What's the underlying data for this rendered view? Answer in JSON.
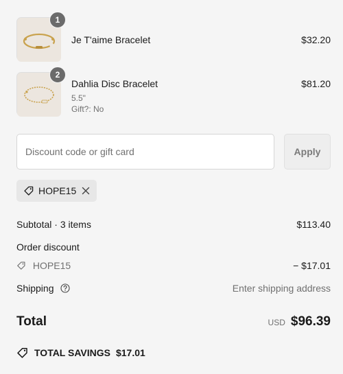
{
  "items": [
    {
      "quantity": "1",
      "name": "Je T'aime Bracelet",
      "price": "$32.20",
      "thumbnail_icon": "cuff-bracelet-image"
    },
    {
      "quantity": "2",
      "name": "Dahlia Disc Bracelet",
      "variant": "5.5\"",
      "gift": "Gift?: No",
      "price": "$81.20",
      "thumbnail_icon": "chain-bracelet-image"
    }
  ],
  "discount": {
    "placeholder": "Discount code or gift card",
    "value": "",
    "apply_label": "Apply",
    "applied_code": "HOPE15"
  },
  "summary": {
    "subtotal_label": "Subtotal · 3 items",
    "subtotal_value": "$113.40",
    "order_discount_label": "Order discount",
    "discount_code": "HOPE15",
    "discount_value": "− $17.01",
    "shipping_label": "Shipping",
    "shipping_value": "Enter shipping address",
    "total_label": "Total",
    "currency": "USD",
    "total_value": "$96.39",
    "savings_label": "TOTAL SAVINGS",
    "savings_value": "$17.01"
  },
  "colors": {
    "background": "#f5f5f5",
    "text": "#1a1a1a",
    "muted": "#707070",
    "badge": "#6b6b6b"
  }
}
